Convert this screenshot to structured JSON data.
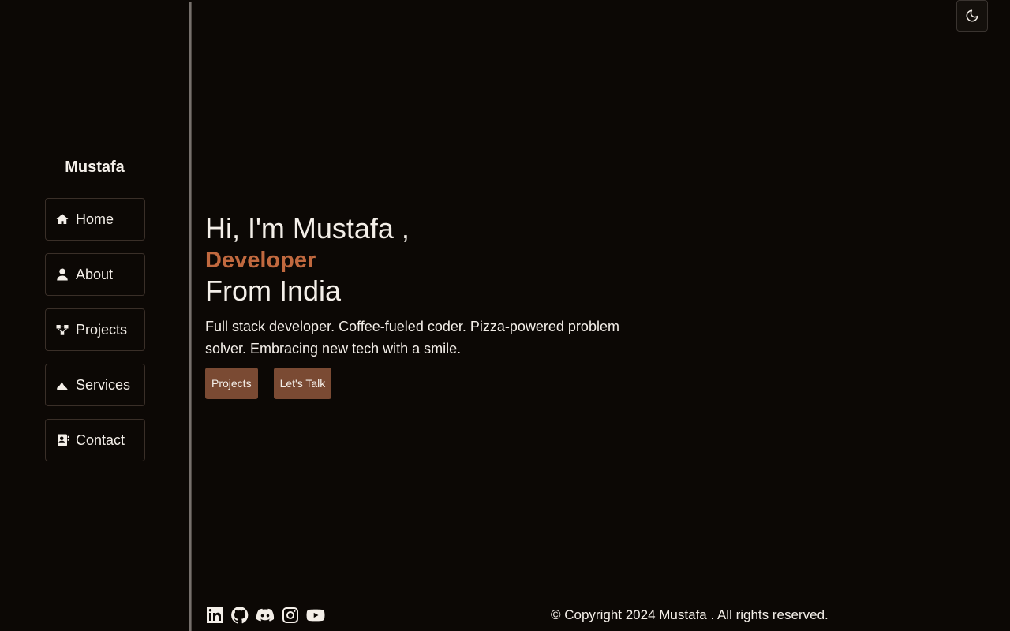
{
  "sidebar": {
    "brand": "Mustafa",
    "items": [
      {
        "label": "Home",
        "icon": "home-icon"
      },
      {
        "label": "About",
        "icon": "user-icon"
      },
      {
        "label": "Projects",
        "icon": "projects-icon"
      },
      {
        "label": "Services",
        "icon": "services-icon"
      },
      {
        "label": "Contact",
        "icon": "contact-icon"
      }
    ]
  },
  "header": {
    "theme_toggle_icon": "moon-icon"
  },
  "hero": {
    "line1": "Hi, I'm Mustafa ,",
    "role": "Developer",
    "line3": "From India",
    "description": "Full stack developer. Coffee-fueled coder. Pizza-powered problem solver. Embracing new tech with a smile.",
    "buttons": {
      "projects": "Projects",
      "talk": "Let's Talk"
    }
  },
  "footer": {
    "socials": [
      "linkedin-icon",
      "github-icon",
      "discord-icon",
      "instagram-icon",
      "youtube-icon"
    ],
    "copyright": "© Copyright 2024 Mustafa . All rights reserved."
  },
  "colors": {
    "background": "#0c0805",
    "accent": "#c1693f",
    "button": "#7a4a33",
    "text": "#f4efe9"
  }
}
